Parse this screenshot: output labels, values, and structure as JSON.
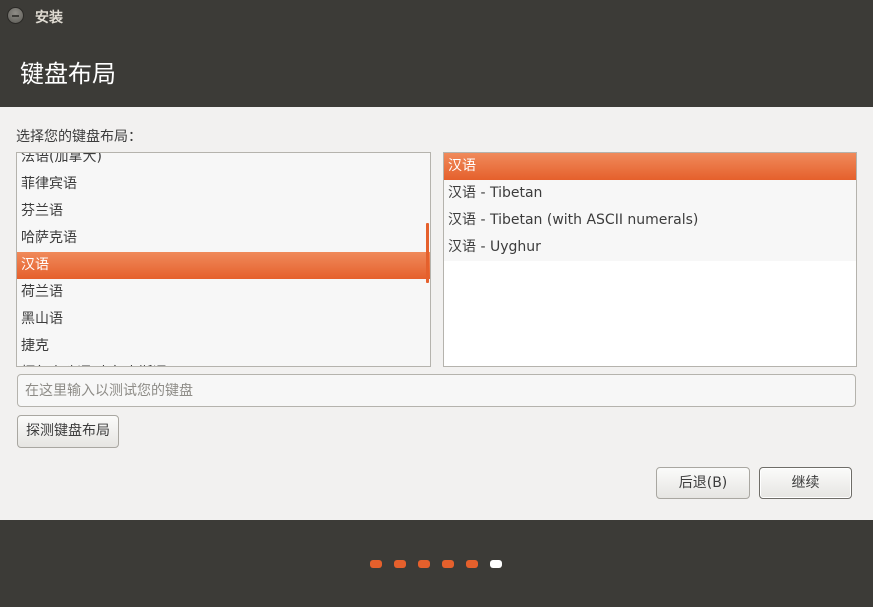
{
  "window": {
    "title": "安装"
  },
  "page": {
    "title": "键盘布局",
    "prompt": "选择您的键盘布局："
  },
  "layouts": {
    "items": [
      "法语(加拿大)",
      "菲律宾语",
      "芬兰语",
      "哈萨克语",
      "汉语",
      "荷兰语",
      "黑山语",
      "捷克",
      "柯尔克孜语(吉尔吉斯语)"
    ],
    "selected": "汉语"
  },
  "variants": {
    "items": [
      "汉语",
      "汉语 - Tibetan",
      "汉语 - Tibetan (with ASCII numerals)",
      "汉语 - Uyghur"
    ],
    "selected": "汉语"
  },
  "test_input": {
    "placeholder": "在这里输入以测试您的键盘",
    "value": ""
  },
  "buttons": {
    "detect": "探测键盘布局",
    "back": "后退(B)",
    "continue": "继续"
  },
  "progress": {
    "total_steps": 6,
    "current_step": 6,
    "done_color": "#e5602c",
    "current_color": "#ffffff"
  },
  "colors": {
    "accent": "#e5602c",
    "header_bg": "#3c3b37"
  }
}
